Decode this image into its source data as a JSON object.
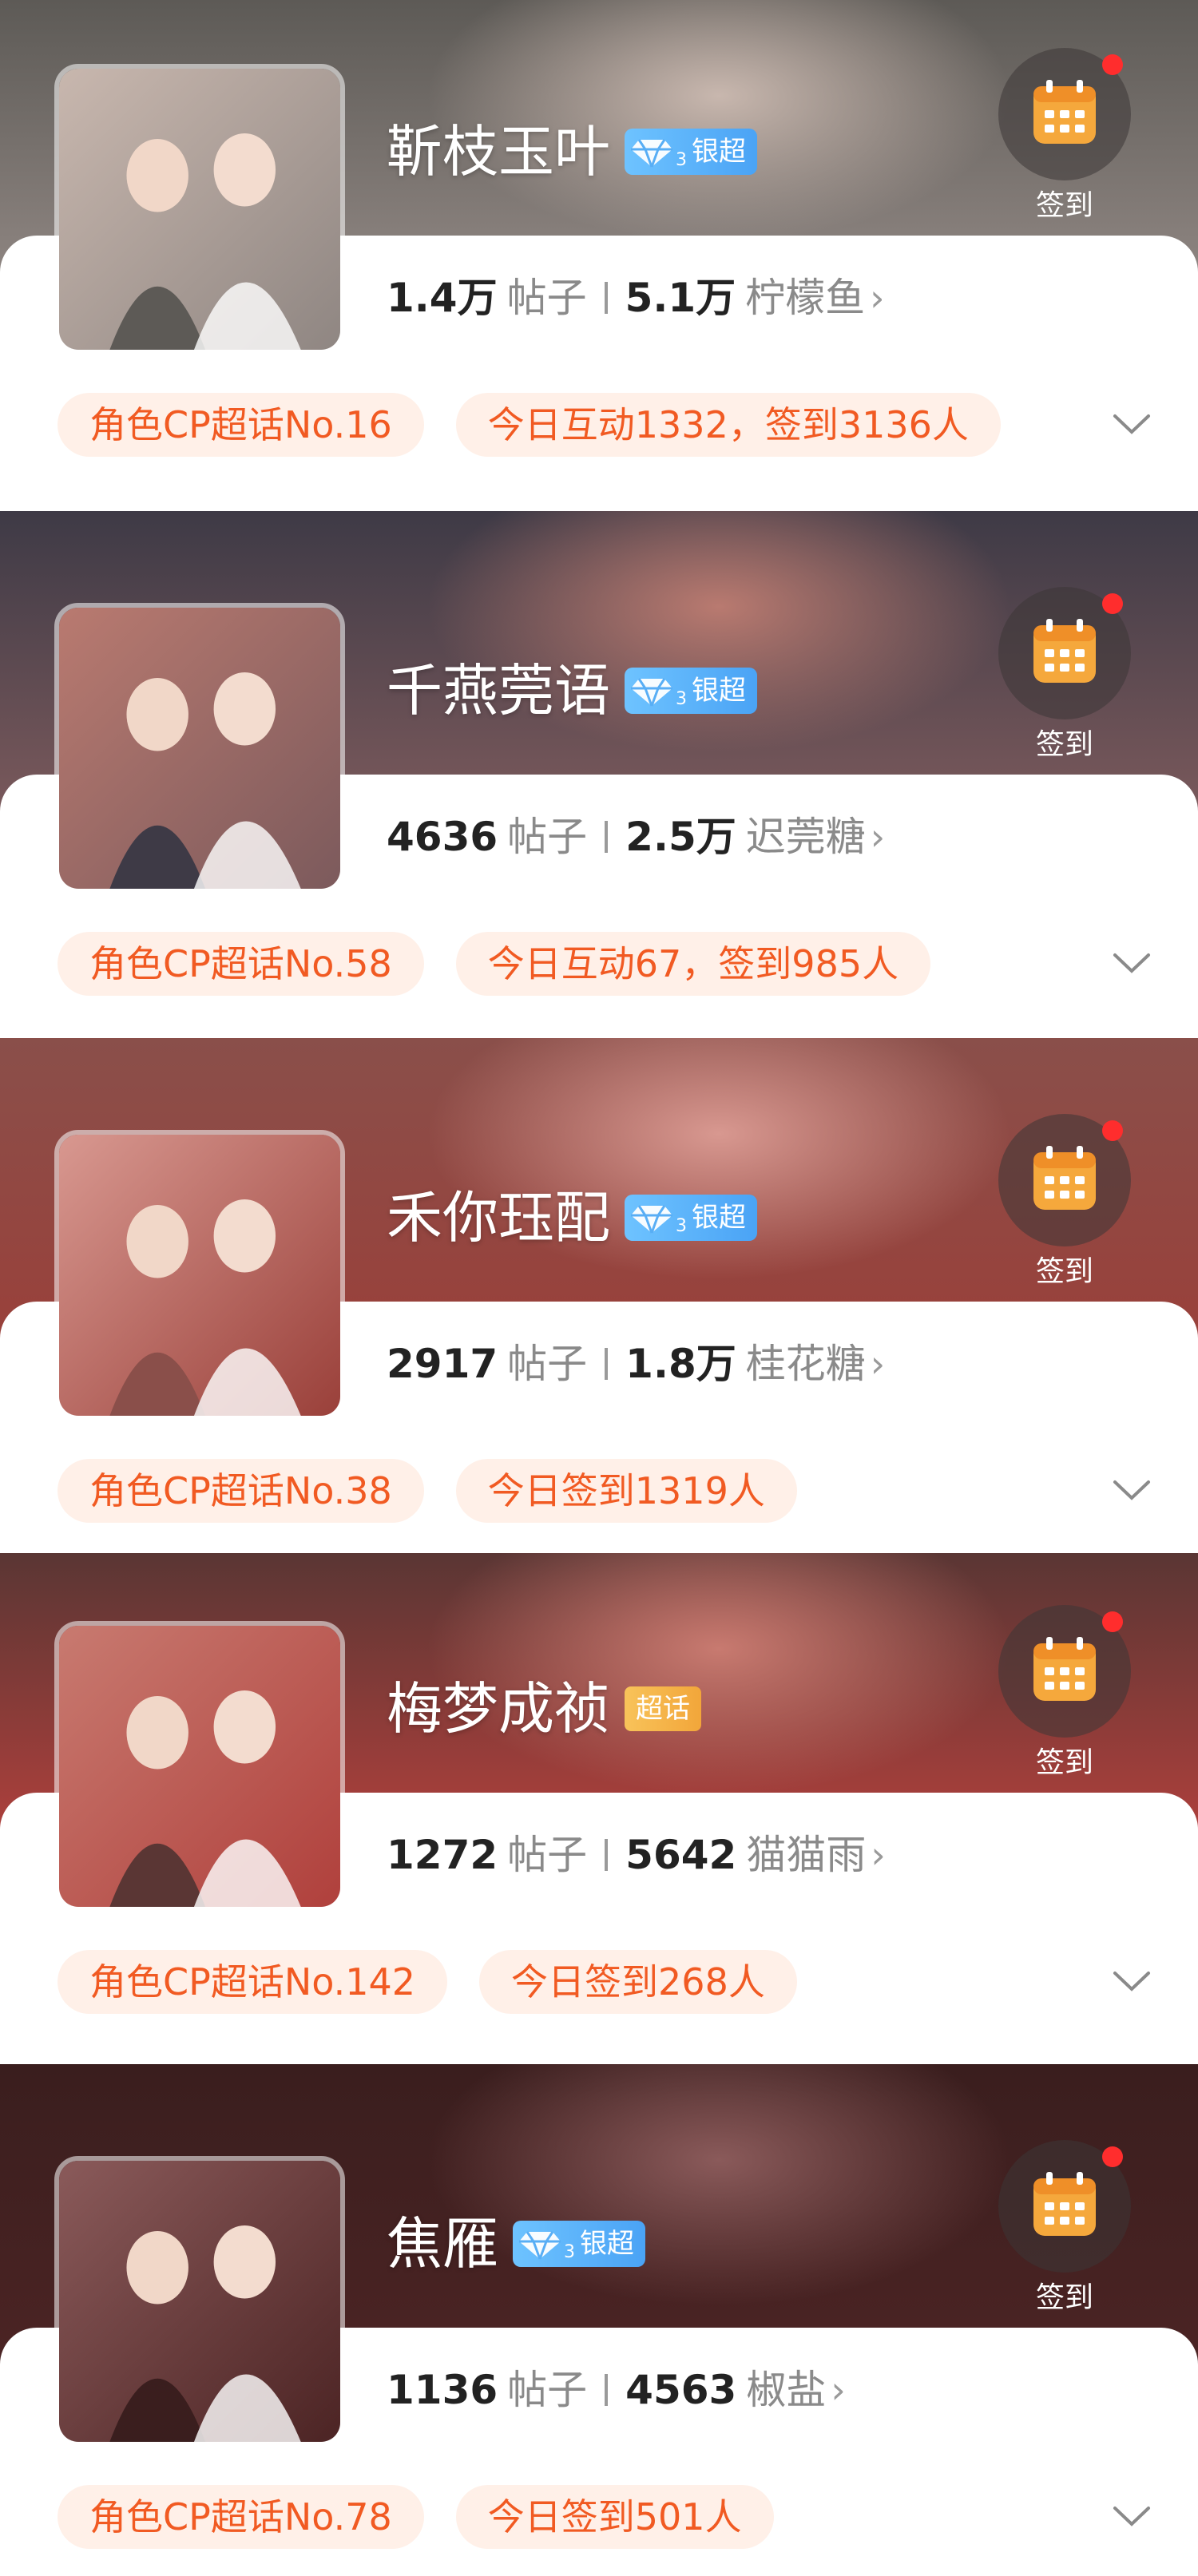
{
  "checkin_label": "签到",
  "posts_unit": "帖子",
  "topics": [
    {
      "name": "靳枝玉叶",
      "badge": {
        "type": "silver",
        "text": "银超"
      },
      "posts": "1.4万",
      "fans": "5.1万",
      "fan_name": "柠檬鱼",
      "rank_tag": "角色CP超话No.16",
      "activity_tag": "今日互动1332，签到3136人",
      "colors": {
        "bg_top": "#5d5a56",
        "bg_bottom": "#8f8682",
        "glow": "#c8b7ae"
      }
    },
    {
      "name": "千燕莞语",
      "badge": {
        "type": "silver",
        "text": "银超"
      },
      "posts": "4636",
      "fans": "2.5万",
      "fan_name": "迟莞糖",
      "rank_tag": "角色CP超话No.58",
      "activity_tag": "今日互动67，签到985人",
      "colors": {
        "bg_top": "#3e3a46",
        "bg_bottom": "#7c5a5c",
        "glow": "#b97a70"
      }
    },
    {
      "name": "禾你珏配",
      "badge": {
        "type": "silver",
        "text": "银超"
      },
      "posts": "2917",
      "fans": "1.8万",
      "fan_name": "桂花糖",
      "rank_tag": "角色CP超话No.38",
      "activity_tag": "今日签到1319人",
      "colors": {
        "bg_top": "#8a4f4a",
        "bg_bottom": "#9a403a",
        "glow": "#d89890"
      }
    },
    {
      "name": "梅梦成祯",
      "badge": {
        "type": "plain",
        "text": "超话"
      },
      "posts": "1272",
      "fans": "5642",
      "fan_name": "猫猫雨",
      "rank_tag": "角色CP超话No.142",
      "activity_tag": "今日签到268人",
      "colors": {
        "bg_top": "#5a3634",
        "bg_bottom": "#b0403c",
        "glow": "#c87a70"
      }
    },
    {
      "name": "焦雁",
      "badge": {
        "type": "silver",
        "text": "银超"
      },
      "posts": "1136",
      "fans": "4563",
      "fan_name": "椒盐",
      "rank_tag": "角色CP超话No.78",
      "activity_tag": "今日签到501人",
      "colors": {
        "bg_top": "#3a1e1e",
        "bg_bottom": "#4c2424",
        "glow": "#8a5a5a"
      }
    }
  ]
}
